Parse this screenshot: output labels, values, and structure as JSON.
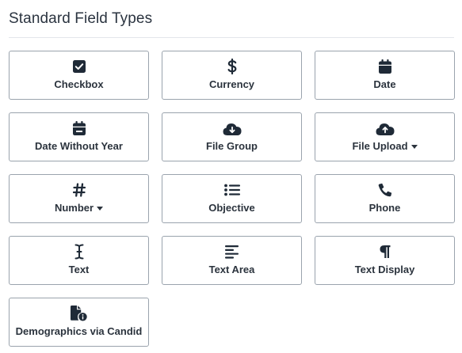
{
  "section": {
    "title": "Standard Field Types"
  },
  "field_types": [
    {
      "label": "Checkbox",
      "icon": "checkbox-icon",
      "has_dropdown": false
    },
    {
      "label": "Currency",
      "icon": "dollar-icon",
      "has_dropdown": false
    },
    {
      "label": "Date",
      "icon": "calendar-icon",
      "has_dropdown": false
    },
    {
      "label": "Date Without Year",
      "icon": "calendar-minus-icon",
      "has_dropdown": false
    },
    {
      "label": "File Group",
      "icon": "cloud-download-icon",
      "has_dropdown": false
    },
    {
      "label": "File Upload",
      "icon": "cloud-upload-icon",
      "has_dropdown": true
    },
    {
      "label": "Number",
      "icon": "hashtag-icon",
      "has_dropdown": true
    },
    {
      "label": "Objective",
      "icon": "list-icon",
      "has_dropdown": false
    },
    {
      "label": "Phone",
      "icon": "phone-icon",
      "has_dropdown": false
    },
    {
      "label": "Text",
      "icon": "text-cursor-icon",
      "has_dropdown": false
    },
    {
      "label": "Text Area",
      "icon": "align-left-icon",
      "has_dropdown": false
    },
    {
      "label": "Text Display",
      "icon": "paragraph-icon",
      "has_dropdown": false
    },
    {
      "label": "Demographics via Candid",
      "icon": "file-info-icon",
      "has_dropdown": false
    }
  ],
  "colors": {
    "icon": "#1f2a37",
    "border": "#9aa3ad",
    "title": "#2b3440"
  }
}
